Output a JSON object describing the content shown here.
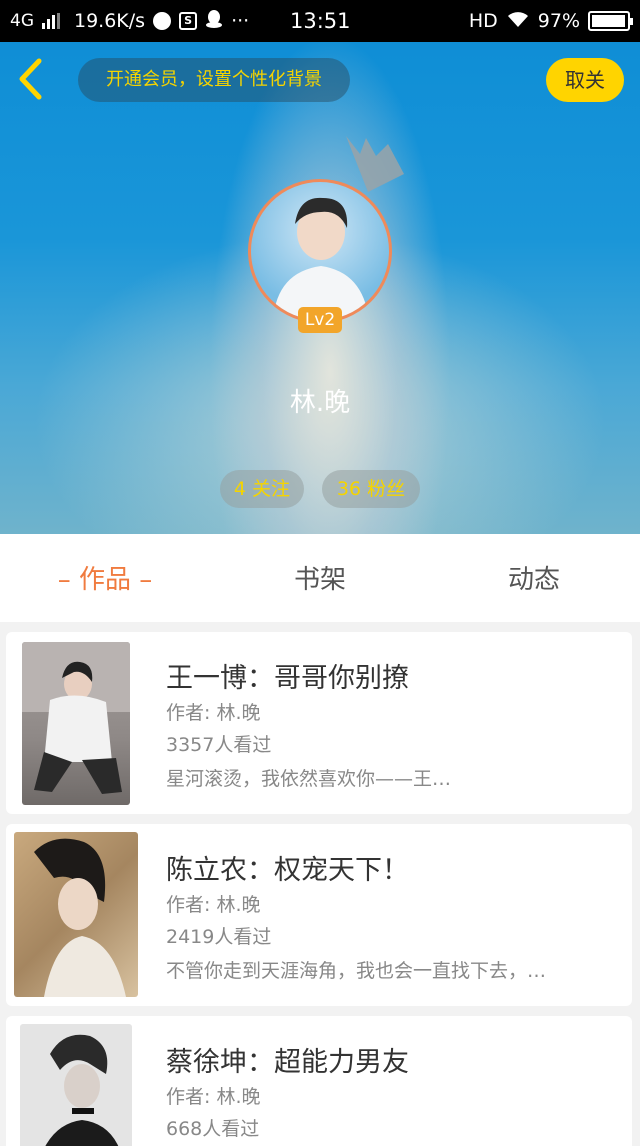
{
  "status_bar": {
    "network": "4G",
    "speed": "19.6K/s",
    "more": "···",
    "time": "13:51",
    "hd": "HD",
    "battery": "97%"
  },
  "header": {
    "vip_banner": "开通会员，设置个性化背景",
    "unfollow_label": "取关",
    "level": "Lv2",
    "username": "林.晚",
    "following": "4 关注",
    "fans": "36 粉丝"
  },
  "tabs": [
    {
      "label": "– 作品 –",
      "active": true
    },
    {
      "label": "书架",
      "active": false
    },
    {
      "label": "动态",
      "active": false
    }
  ],
  "works": [
    {
      "title": "王一博：哥哥你别撩",
      "author": "作者: 林.晚",
      "views": "3357人看过",
      "desc": "星河滚烫，我依然喜欢你——王…"
    },
    {
      "title": "陈立农：权宠天下！",
      "author": "作者: 林.晚",
      "views": "2419人看过",
      "desc": "不管你走到天涯海角，我也会一直找下去，…"
    },
    {
      "title": "蔡徐坤：超能力男友",
      "author": "作者: 林.晚",
      "views": "668人看过",
      "desc": ""
    }
  ],
  "colors": {
    "accent": "#f07b3f",
    "yellow": "#ffd400",
    "header_blue": "#1a96d8"
  }
}
